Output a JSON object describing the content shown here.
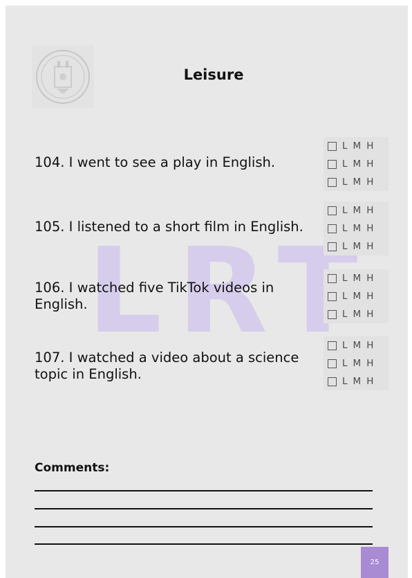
{
  "header": {
    "title": "Leisure"
  },
  "watermark": "LRT",
  "rating_labels": [
    "L",
    "M",
    "H"
  ],
  "items": [
    {
      "text": "104. I went to see a play in English."
    },
    {
      "text": "105. I listened to a short film in English."
    },
    {
      "text": "106. I watched five TikTok videos in English."
    },
    {
      "text": "107. I watched a video about a science topic in English."
    }
  ],
  "comments": {
    "label": "Comments:"
  },
  "footer": {
    "page_number": "25"
  },
  "colors": {
    "page_bg": "#e8e8e8",
    "accent": "#a98bd4",
    "watermark": "#c9b8f0"
  }
}
